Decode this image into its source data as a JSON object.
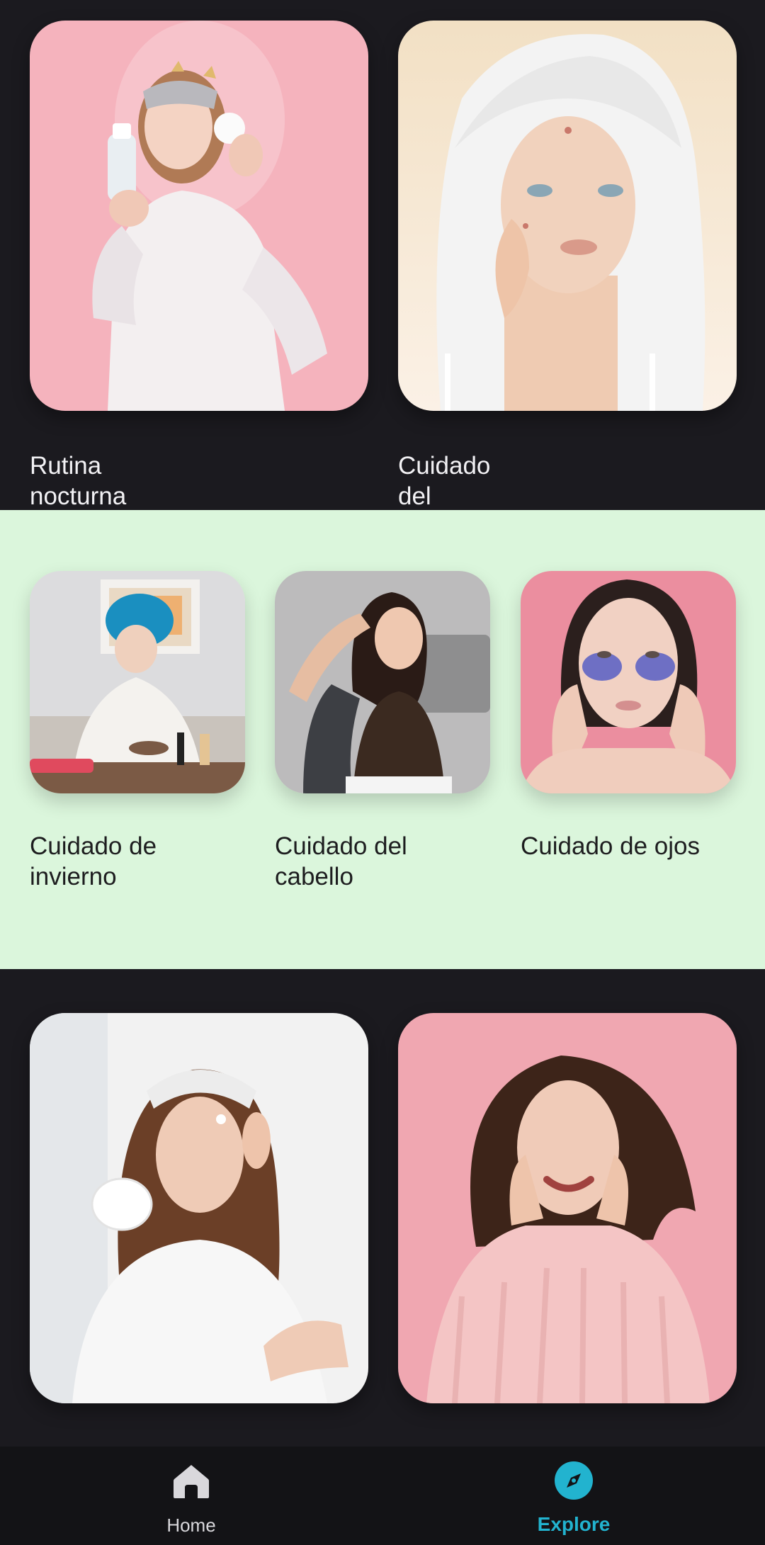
{
  "sections": [
    {
      "theme": "dark",
      "cards": [
        {
          "label": "Rutina nocturna",
          "image": "woman-pajamas-sleep-mask-pink-background"
        },
        {
          "label": "Cuidado del acné",
          "image": "woman-towel-acne-cream-background"
        }
      ]
    },
    {
      "theme": "light-green",
      "cards": [
        {
          "label": "Cuidado de invierno",
          "image": "woman-bathrobe-blue-towel-mirror"
        },
        {
          "label": "Cuidado del cabello",
          "image": "woman-brown-top-touching-hair"
        },
        {
          "label": "Cuidado de ojos",
          "image": "woman-under-eye-patches-pink-background"
        }
      ]
    },
    {
      "theme": "dark",
      "cards": [
        {
          "label": "",
          "image": "woman-headband-applying-cream"
        },
        {
          "label": "",
          "image": "woman-pink-sweater-smiling-winking"
        }
      ]
    }
  ],
  "bottom_nav": {
    "items": [
      {
        "label": "Home",
        "icon": "home-icon",
        "active": false
      },
      {
        "label": "Explore",
        "icon": "compass-icon",
        "active": true
      }
    ],
    "active_color": "#22b3cf"
  }
}
